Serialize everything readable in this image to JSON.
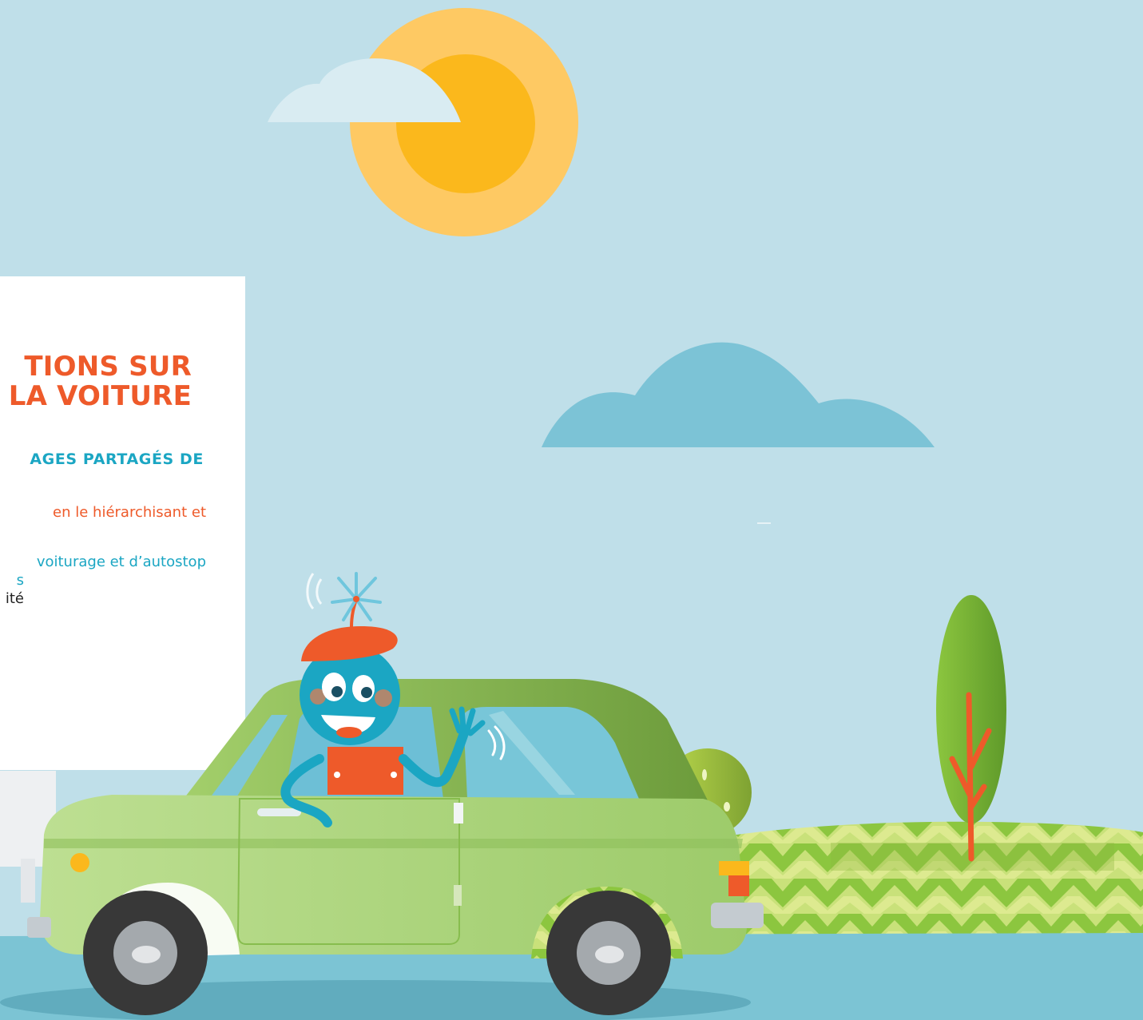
{
  "panel": {
    "title_line1": "TIONS SUR",
    "title_line2": "LA VOITURE",
    "subtitle": "AGES PARTAGÉS DE",
    "line1": "en le hiérarchisant et",
    "line2": "voiturage et d’autostop",
    "line3": "s",
    "line4": "ité"
  },
  "colors": {
    "sky": "#bfdfe9",
    "title_orange": "#ee5a2a",
    "teal": "#1ba6c3",
    "car_green": "#a7cf74",
    "road": "#7cc4d4"
  },
  "icons": [
    "sun-icon",
    "cloud-icon",
    "car-icon",
    "mascot-character",
    "tree-icon",
    "bush-icon"
  ]
}
